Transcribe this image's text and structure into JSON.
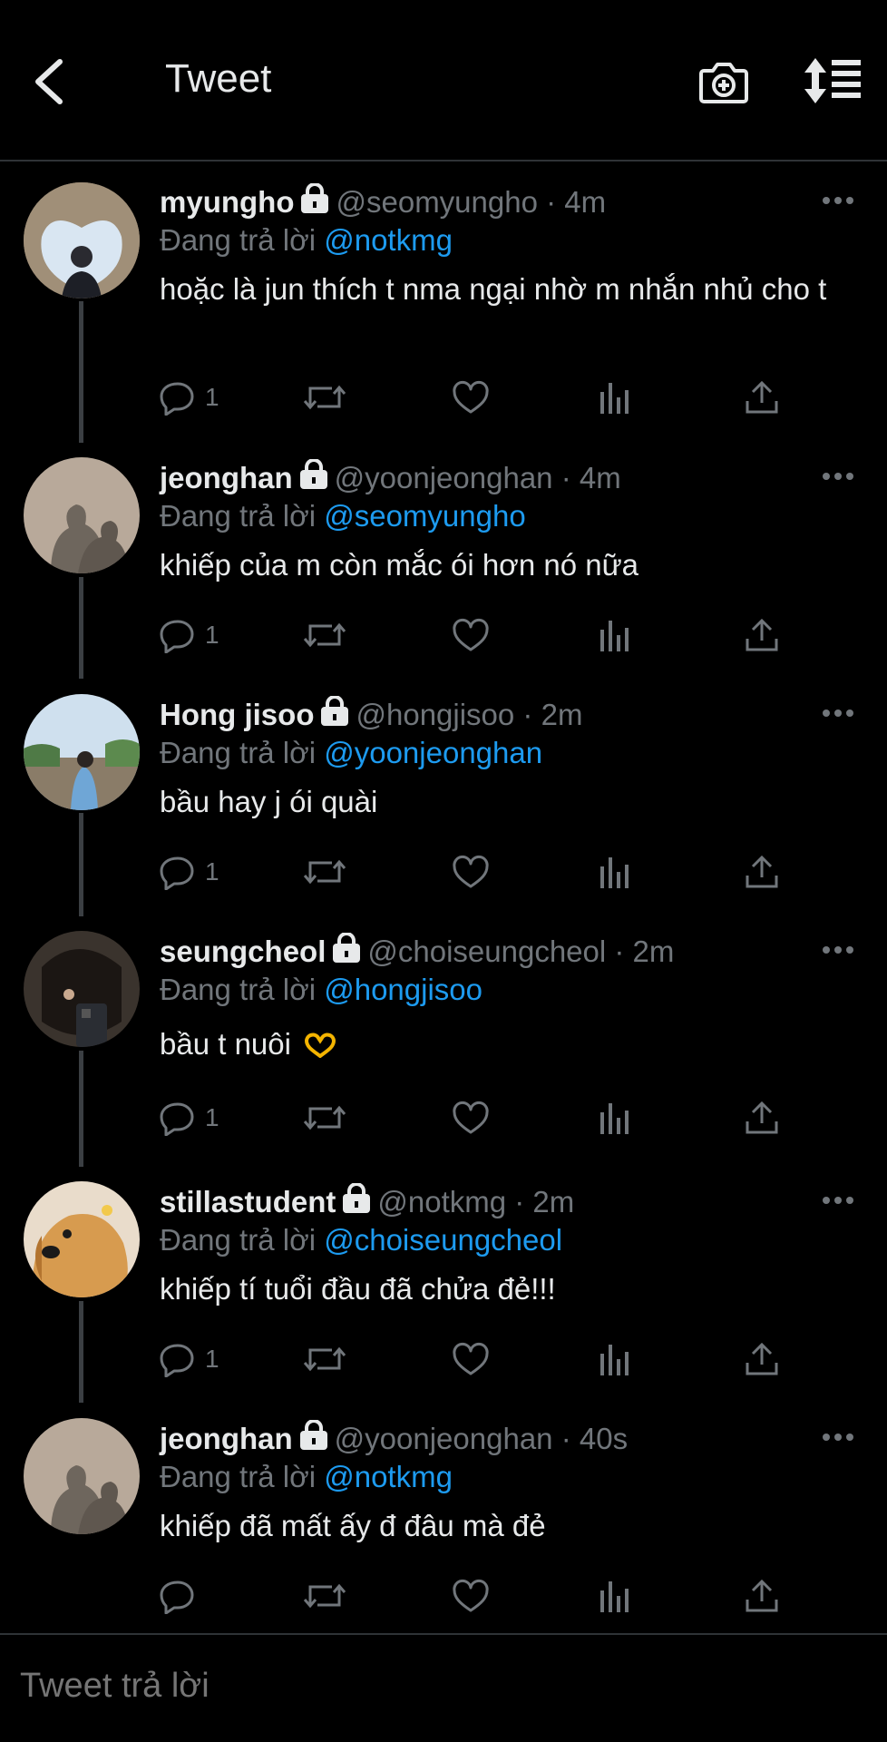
{
  "header": {
    "title": "Tweet"
  },
  "tweets": [
    {
      "name": "myungho",
      "handle": "@seomyungho · 4m",
      "replying_prefix": "Đang trả lời",
      "mention": "@notkmg",
      "text": "hoặc là jun thích t nma ngại nhờ m nhắn nhủ cho t",
      "replies": "1"
    },
    {
      "name": "jeonghan",
      "handle": "@yoonjeonghan · 4m",
      "replying_prefix": "Đang trả lời",
      "mention": "@seomyungho",
      "text": "khiếp của m còn mắc ói hơn nó nữa",
      "replies": "1"
    },
    {
      "name": "Hong jisoo",
      "handle": "@hongjisoo · 2m",
      "replying_prefix": "Đang trả lời",
      "mention": "@yoonjeonghan",
      "text": "bầu hay j ói quài",
      "replies": "1"
    },
    {
      "name": "seungcheol",
      "handle": "@choiseungcheol · 2m",
      "replying_prefix": "Đang trả lời",
      "mention": "@hongjisoo",
      "text": "bầu t nuôi",
      "replies": "1"
    },
    {
      "name": "stillastudent",
      "handle": "@notkmg · 2m",
      "replying_prefix": "Đang trả lời",
      "mention": "@choiseungcheol",
      "text": "khiếp tí tuổi đầu đã chửa đẻ!!!",
      "replies": "1"
    },
    {
      "name": "jeonghan",
      "handle": "@yoonjeonghan · 40s",
      "replying_prefix": "Đang trả lời",
      "mention": "@notkmg",
      "text": "khiếp đã mất ấy đ đâu mà đẻ",
      "replies": ""
    }
  ],
  "footer": {
    "placeholder": "Tweet trả lời"
  },
  "colors": {
    "accent": "#1d9bf0",
    "muted": "#71767b",
    "background": "#000000",
    "emoji": "#f4b400"
  },
  "icons": [
    "back-arrow-icon",
    "camera-plus-icon",
    "sort-icon",
    "lock-icon",
    "more-icon",
    "reply-icon",
    "retweet-icon",
    "like-icon",
    "analytics-icon",
    "share-icon",
    "heart-hands-emoji"
  ]
}
